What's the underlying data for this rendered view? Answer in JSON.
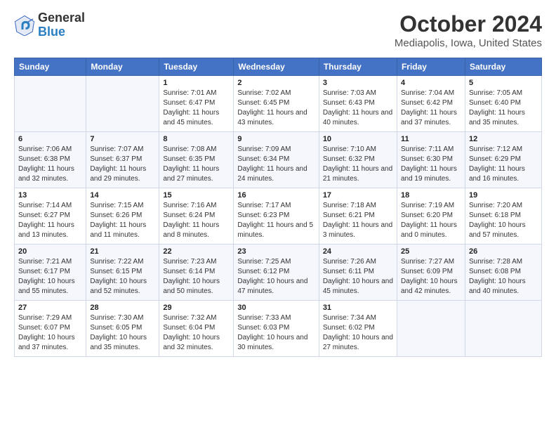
{
  "logo": {
    "general": "General",
    "blue": "Blue"
  },
  "title": "October 2024",
  "subtitle": "Mediapolis, Iowa, United States",
  "days_of_week": [
    "Sunday",
    "Monday",
    "Tuesday",
    "Wednesday",
    "Thursday",
    "Friday",
    "Saturday"
  ],
  "weeks": [
    [
      {
        "day": "",
        "info": ""
      },
      {
        "day": "",
        "info": ""
      },
      {
        "day": "1",
        "info": "Sunrise: 7:01 AM\nSunset: 6:47 PM\nDaylight: 11 hours and 45 minutes."
      },
      {
        "day": "2",
        "info": "Sunrise: 7:02 AM\nSunset: 6:45 PM\nDaylight: 11 hours and 43 minutes."
      },
      {
        "day": "3",
        "info": "Sunrise: 7:03 AM\nSunset: 6:43 PM\nDaylight: 11 hours and 40 minutes."
      },
      {
        "day": "4",
        "info": "Sunrise: 7:04 AM\nSunset: 6:42 PM\nDaylight: 11 hours and 37 minutes."
      },
      {
        "day": "5",
        "info": "Sunrise: 7:05 AM\nSunset: 6:40 PM\nDaylight: 11 hours and 35 minutes."
      }
    ],
    [
      {
        "day": "6",
        "info": "Sunrise: 7:06 AM\nSunset: 6:38 PM\nDaylight: 11 hours and 32 minutes."
      },
      {
        "day": "7",
        "info": "Sunrise: 7:07 AM\nSunset: 6:37 PM\nDaylight: 11 hours and 29 minutes."
      },
      {
        "day": "8",
        "info": "Sunrise: 7:08 AM\nSunset: 6:35 PM\nDaylight: 11 hours and 27 minutes."
      },
      {
        "day": "9",
        "info": "Sunrise: 7:09 AM\nSunset: 6:34 PM\nDaylight: 11 hours and 24 minutes."
      },
      {
        "day": "10",
        "info": "Sunrise: 7:10 AM\nSunset: 6:32 PM\nDaylight: 11 hours and 21 minutes."
      },
      {
        "day": "11",
        "info": "Sunrise: 7:11 AM\nSunset: 6:30 PM\nDaylight: 11 hours and 19 minutes."
      },
      {
        "day": "12",
        "info": "Sunrise: 7:12 AM\nSunset: 6:29 PM\nDaylight: 11 hours and 16 minutes."
      }
    ],
    [
      {
        "day": "13",
        "info": "Sunrise: 7:14 AM\nSunset: 6:27 PM\nDaylight: 11 hours and 13 minutes."
      },
      {
        "day": "14",
        "info": "Sunrise: 7:15 AM\nSunset: 6:26 PM\nDaylight: 11 hours and 11 minutes."
      },
      {
        "day": "15",
        "info": "Sunrise: 7:16 AM\nSunset: 6:24 PM\nDaylight: 11 hours and 8 minutes."
      },
      {
        "day": "16",
        "info": "Sunrise: 7:17 AM\nSunset: 6:23 PM\nDaylight: 11 hours and 5 minutes."
      },
      {
        "day": "17",
        "info": "Sunrise: 7:18 AM\nSunset: 6:21 PM\nDaylight: 11 hours and 3 minutes."
      },
      {
        "day": "18",
        "info": "Sunrise: 7:19 AM\nSunset: 6:20 PM\nDaylight: 11 hours and 0 minutes."
      },
      {
        "day": "19",
        "info": "Sunrise: 7:20 AM\nSunset: 6:18 PM\nDaylight: 10 hours and 57 minutes."
      }
    ],
    [
      {
        "day": "20",
        "info": "Sunrise: 7:21 AM\nSunset: 6:17 PM\nDaylight: 10 hours and 55 minutes."
      },
      {
        "day": "21",
        "info": "Sunrise: 7:22 AM\nSunset: 6:15 PM\nDaylight: 10 hours and 52 minutes."
      },
      {
        "day": "22",
        "info": "Sunrise: 7:23 AM\nSunset: 6:14 PM\nDaylight: 10 hours and 50 minutes."
      },
      {
        "day": "23",
        "info": "Sunrise: 7:25 AM\nSunset: 6:12 PM\nDaylight: 10 hours and 47 minutes."
      },
      {
        "day": "24",
        "info": "Sunrise: 7:26 AM\nSunset: 6:11 PM\nDaylight: 10 hours and 45 minutes."
      },
      {
        "day": "25",
        "info": "Sunrise: 7:27 AM\nSunset: 6:09 PM\nDaylight: 10 hours and 42 minutes."
      },
      {
        "day": "26",
        "info": "Sunrise: 7:28 AM\nSunset: 6:08 PM\nDaylight: 10 hours and 40 minutes."
      }
    ],
    [
      {
        "day": "27",
        "info": "Sunrise: 7:29 AM\nSunset: 6:07 PM\nDaylight: 10 hours and 37 minutes."
      },
      {
        "day": "28",
        "info": "Sunrise: 7:30 AM\nSunset: 6:05 PM\nDaylight: 10 hours and 35 minutes."
      },
      {
        "day": "29",
        "info": "Sunrise: 7:32 AM\nSunset: 6:04 PM\nDaylight: 10 hours and 32 minutes."
      },
      {
        "day": "30",
        "info": "Sunrise: 7:33 AM\nSunset: 6:03 PM\nDaylight: 10 hours and 30 minutes."
      },
      {
        "day": "31",
        "info": "Sunrise: 7:34 AM\nSunset: 6:02 PM\nDaylight: 10 hours and 27 minutes."
      },
      {
        "day": "",
        "info": ""
      },
      {
        "day": "",
        "info": ""
      }
    ]
  ]
}
